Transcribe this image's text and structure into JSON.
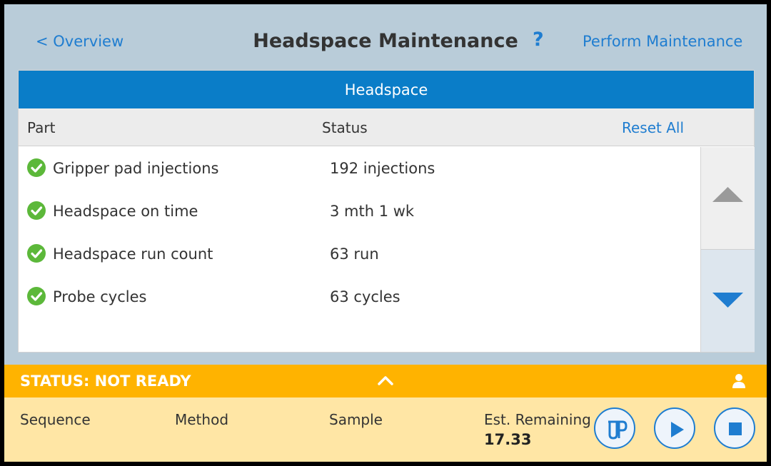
{
  "header": {
    "back_label": "< Overview",
    "title": "Headspace Maintenance",
    "help_label": "?",
    "perform_label": "Perform Maintenance"
  },
  "panel": {
    "title": "Headspace",
    "columns": {
      "part": "Part",
      "status": "Status"
    },
    "reset_label": "Reset All",
    "rows": [
      {
        "part": "Gripper pad injections",
        "status": "192 injections",
        "state": "ok"
      },
      {
        "part": "Headspace on time",
        "status": "3 mth 1 wk",
        "state": "ok"
      },
      {
        "part": "Headspace run count",
        "status": "63 run",
        "state": "ok"
      },
      {
        "part": "Probe cycles",
        "status": "63 cycles",
        "state": "ok"
      }
    ],
    "scroll": {
      "up_icon": "triangle-up-icon",
      "down_icon": "triangle-down-icon"
    }
  },
  "statusbar": {
    "status_text": "STATUS: NOT READY",
    "expand_icon": "chevron-up-icon",
    "user_icon": "user-icon",
    "color": "#ffb300"
  },
  "run_info": {
    "sequence_label": "Sequence",
    "method_label": "Method",
    "sample_label": "Sample",
    "est_remaining_label": "Est. Remaining",
    "est_remaining_value": "17.33",
    "buttons": [
      "vial-probe-icon",
      "play-icon",
      "stop-icon"
    ]
  },
  "colors": {
    "accent": "#0a7dc8",
    "link": "#1f7dd0",
    "ok": "#5cb83a",
    "background": "#b9ccd9",
    "bottom_bar": "#ffe6a5"
  }
}
